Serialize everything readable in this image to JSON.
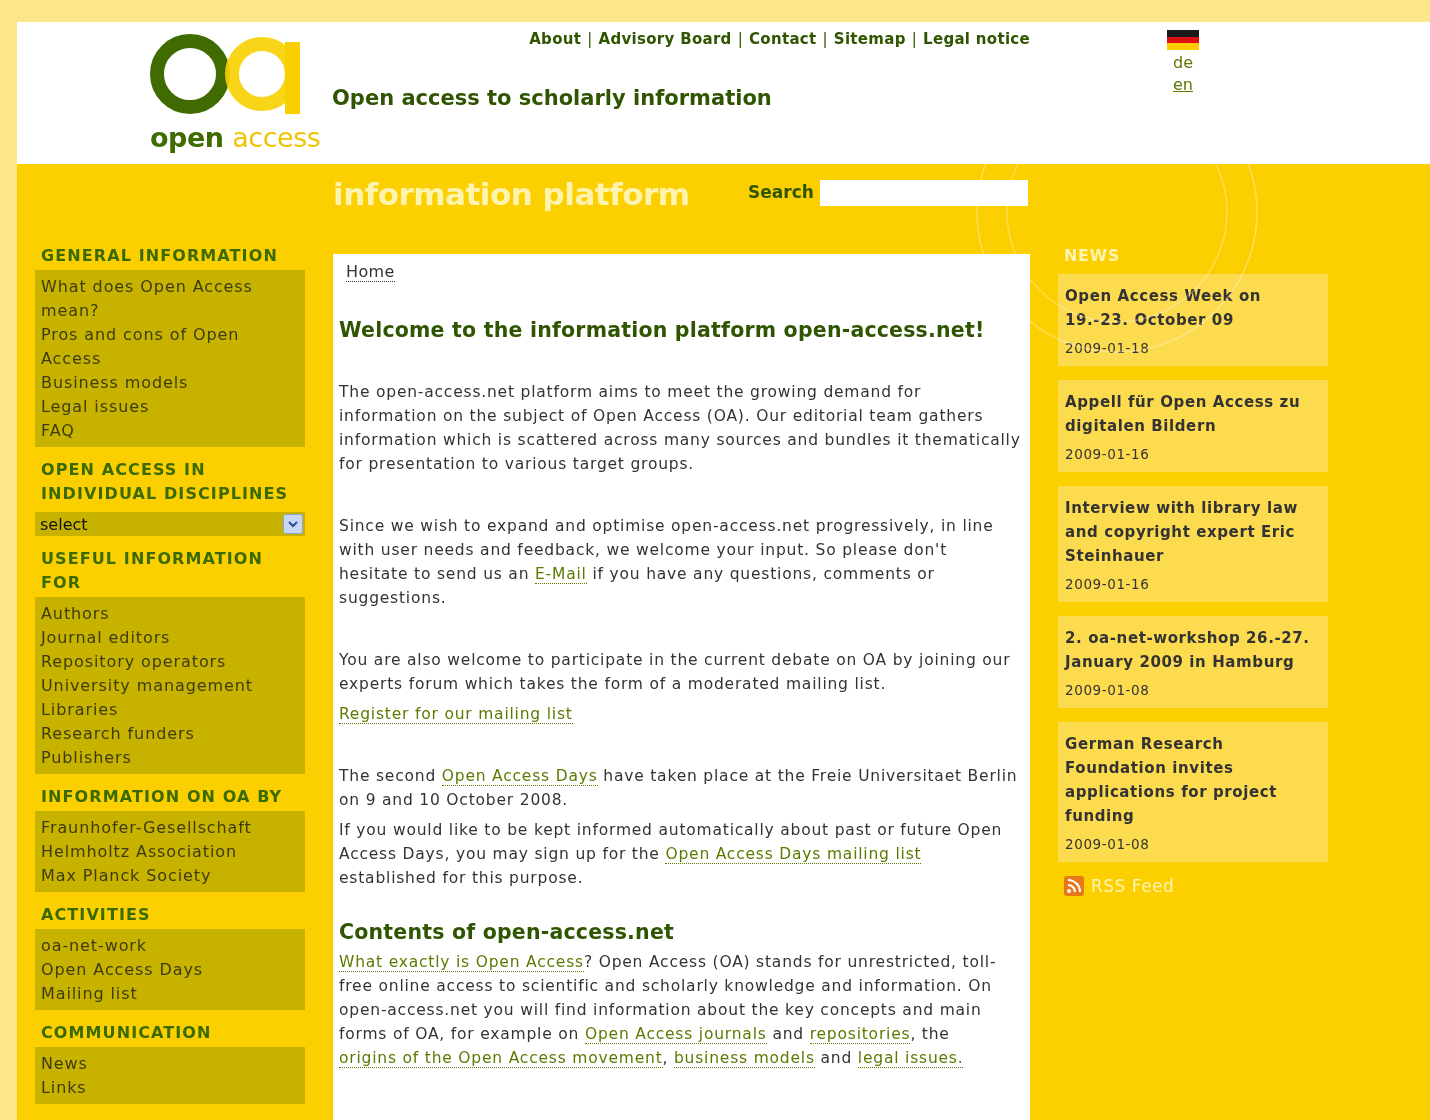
{
  "logo": {
    "word1": "open",
    "word2": "access"
  },
  "top_links": [
    "About",
    "Advisory Board",
    "Contact",
    "Sitemap",
    "Legal notice"
  ],
  "top_links_separator": "|",
  "tagline": "Open access to scholarly information",
  "languages": [
    {
      "label": "de",
      "selected": false
    },
    {
      "label": "en",
      "selected": true
    }
  ],
  "platform_title": "information platform",
  "search": {
    "label": "Search"
  },
  "sidebar": [
    {
      "kind": "list",
      "heading": "GENERAL INFORMATION",
      "items": [
        "What does Open Access mean?",
        "Pros and cons of Open Access",
        "Business models",
        "Legal issues",
        "FAQ"
      ]
    },
    {
      "kind": "select",
      "heading": "OPEN ACCESS IN INDIVIDUAL DISCIPLINES",
      "value": "select"
    },
    {
      "kind": "list",
      "heading": "USEFUL INFORMATION FOR",
      "items": [
        "Authors",
        "Journal editors",
        "Repository operators",
        "University management",
        "Libraries",
        "Research funders",
        "Publishers"
      ]
    },
    {
      "kind": "list",
      "heading": "INFORMATION ON OA BY",
      "items": [
        "Fraunhofer-Gesellschaft",
        "Helmholtz Association",
        "Max Planck Society"
      ]
    },
    {
      "kind": "list",
      "heading": "ACTIVITIES",
      "items": [
        "oa-net-work",
        "Open Access Days",
        "Mailing list"
      ]
    },
    {
      "kind": "list",
      "heading": "COMMUNICATION",
      "items": [
        "News",
        "Links"
      ]
    }
  ],
  "breadcrumb": "Home",
  "content": [
    {
      "kind": "heading",
      "segments": [
        {
          "text": "Welcome to the information platform open-access.net!"
        }
      ]
    },
    {
      "kind": "paragraph",
      "segments": [
        {
          "text": "The open-access.net platform aims to meet the growing demand for information on the subject of Open Access (OA). Our editorial team gathers information which is scattered across many sources and bundles it thematically for presentation to various target groups."
        }
      ]
    },
    {
      "kind": "paragraph",
      "segments": [
        {
          "text": "Since we wish to expand and optimise open-access.net progressively, in line with user needs and feedback, we welcome your input. So please don't hesitate to send us an "
        },
        {
          "link": "E-Mail"
        },
        {
          "text": " if you have any questions, comments or suggestions."
        }
      ]
    },
    {
      "kind": "paragraph",
      "segments": [
        {
          "text": "You are also welcome to participate in the current debate on OA by joining our experts forum which takes the form of a moderated mailing list."
        }
      ]
    },
    {
      "kind": "link",
      "segments": [
        {
          "link": "Register for our mailing list"
        }
      ]
    },
    {
      "kind": "paragraph",
      "segments": [
        {
          "text": "The second "
        },
        {
          "link": "Open Access Days"
        },
        {
          "text": " have taken place at the Freie Universitaet Berlin on 9 and 10 October 2008."
        }
      ]
    },
    {
      "kind": "follow",
      "segments": [
        {
          "text": "If you would like to be kept informed automatically about past or future Open Access Days, you may sign up for the "
        },
        {
          "link": "Open Access Days mailing list"
        },
        {
          "text": " established for this purpose."
        }
      ]
    },
    {
      "kind": "heading",
      "segments": [
        {
          "text": "Contents of open-access.net"
        }
      ]
    },
    {
      "kind": "follow",
      "segments": [
        {
          "link": "What exactly is Open Access"
        },
        {
          "text": "? Open Access (OA) stands for unrestricted, toll-free online access to scientific and scholarly knowledge and information. On open-access.net you will find information about the key concepts and main forms of OA, for example on "
        },
        {
          "link": "Open Access journals"
        },
        {
          "text": " and "
        },
        {
          "link": "repositories"
        },
        {
          "text": ", the "
        },
        {
          "link": "origins of the Open Access movement"
        },
        {
          "text": ", "
        },
        {
          "link": "business models"
        },
        {
          "text": " and "
        },
        {
          "link": "legal issues."
        }
      ]
    }
  ],
  "news_heading": "NEWS",
  "news": [
    {
      "title": "Open Access Week on 19.-23. October 09",
      "date": "2009-01-18"
    },
    {
      "title": "Appell für Open Access zu digitalen Bildern",
      "date": "2009-01-16"
    },
    {
      "title": "Interview with library law and copyright expert Eric Steinhauer",
      "date": "2009-01-16"
    },
    {
      "title": "2. oa-net-workshop 26.-27. January 2009 in Hamburg",
      "date": "2009-01-08"
    },
    {
      "title": "German Research Foundation invites applications for project funding",
      "date": "2009-01-08"
    }
  ],
  "rss": "RSS Feed"
}
